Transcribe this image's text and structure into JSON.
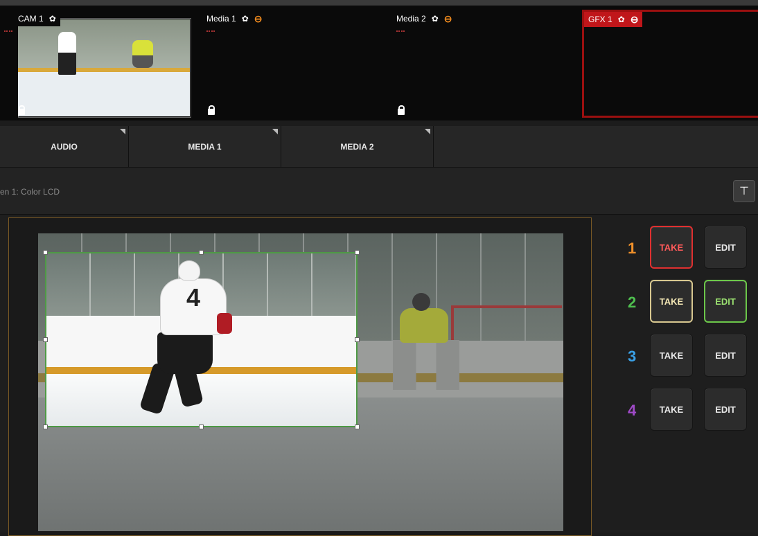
{
  "sources": [
    {
      "id": "cam1",
      "label": "CAM 1",
      "gear_icon": "gear-icon",
      "route_icon": null
    },
    {
      "id": "media1",
      "label": "Media 1",
      "gear_icon": "gear-icon",
      "route_icon": "output-route-icon"
    },
    {
      "id": "media2",
      "label": "Media 2",
      "gear_icon": "gear-icon",
      "route_icon": "output-route-icon"
    },
    {
      "id": "gfx1",
      "label": "GFX 1",
      "gear_icon": "gear-icon",
      "route_icon": "output-route-icon"
    }
  ],
  "tabs": [
    {
      "label": "AUDIO"
    },
    {
      "label": "MEDIA 1"
    },
    {
      "label": "MEDIA 2"
    }
  ],
  "infobar": {
    "label": "en 1: Color LCD"
  },
  "crop_overlay": {
    "jersey_number": "4"
  },
  "layers": [
    {
      "number": "1",
      "take": "TAKE",
      "edit": "EDIT",
      "color": "#f0902a",
      "take_border": "#e03030",
      "take_text": "#ff5a5a",
      "edit_border": "#151515",
      "edit_text": "#e8e8e8"
    },
    {
      "number": "2",
      "take": "TAKE",
      "edit": "EDIT",
      "color": "#4fbf4f",
      "take_border": "#d8c890",
      "take_text": "#f2e6b4",
      "edit_border": "#6cc84a",
      "edit_text": "#9ae070"
    },
    {
      "number": "3",
      "take": "TAKE",
      "edit": "EDIT",
      "color": "#3aa0e6",
      "take_border": "#151515",
      "take_text": "#e8e8e8",
      "edit_border": "#151515",
      "edit_text": "#e8e8e8"
    },
    {
      "number": "4",
      "take": "TAKE",
      "edit": "EDIT",
      "color": "#a04ac8",
      "take_border": "#151515",
      "take_text": "#e8e8e8",
      "edit_border": "#151515",
      "edit_text": "#e8e8e8"
    }
  ],
  "colors": {
    "accent_orange": "#f08a1e",
    "gfx_red": "#c0161a",
    "crop_green": "#4e9a45"
  }
}
